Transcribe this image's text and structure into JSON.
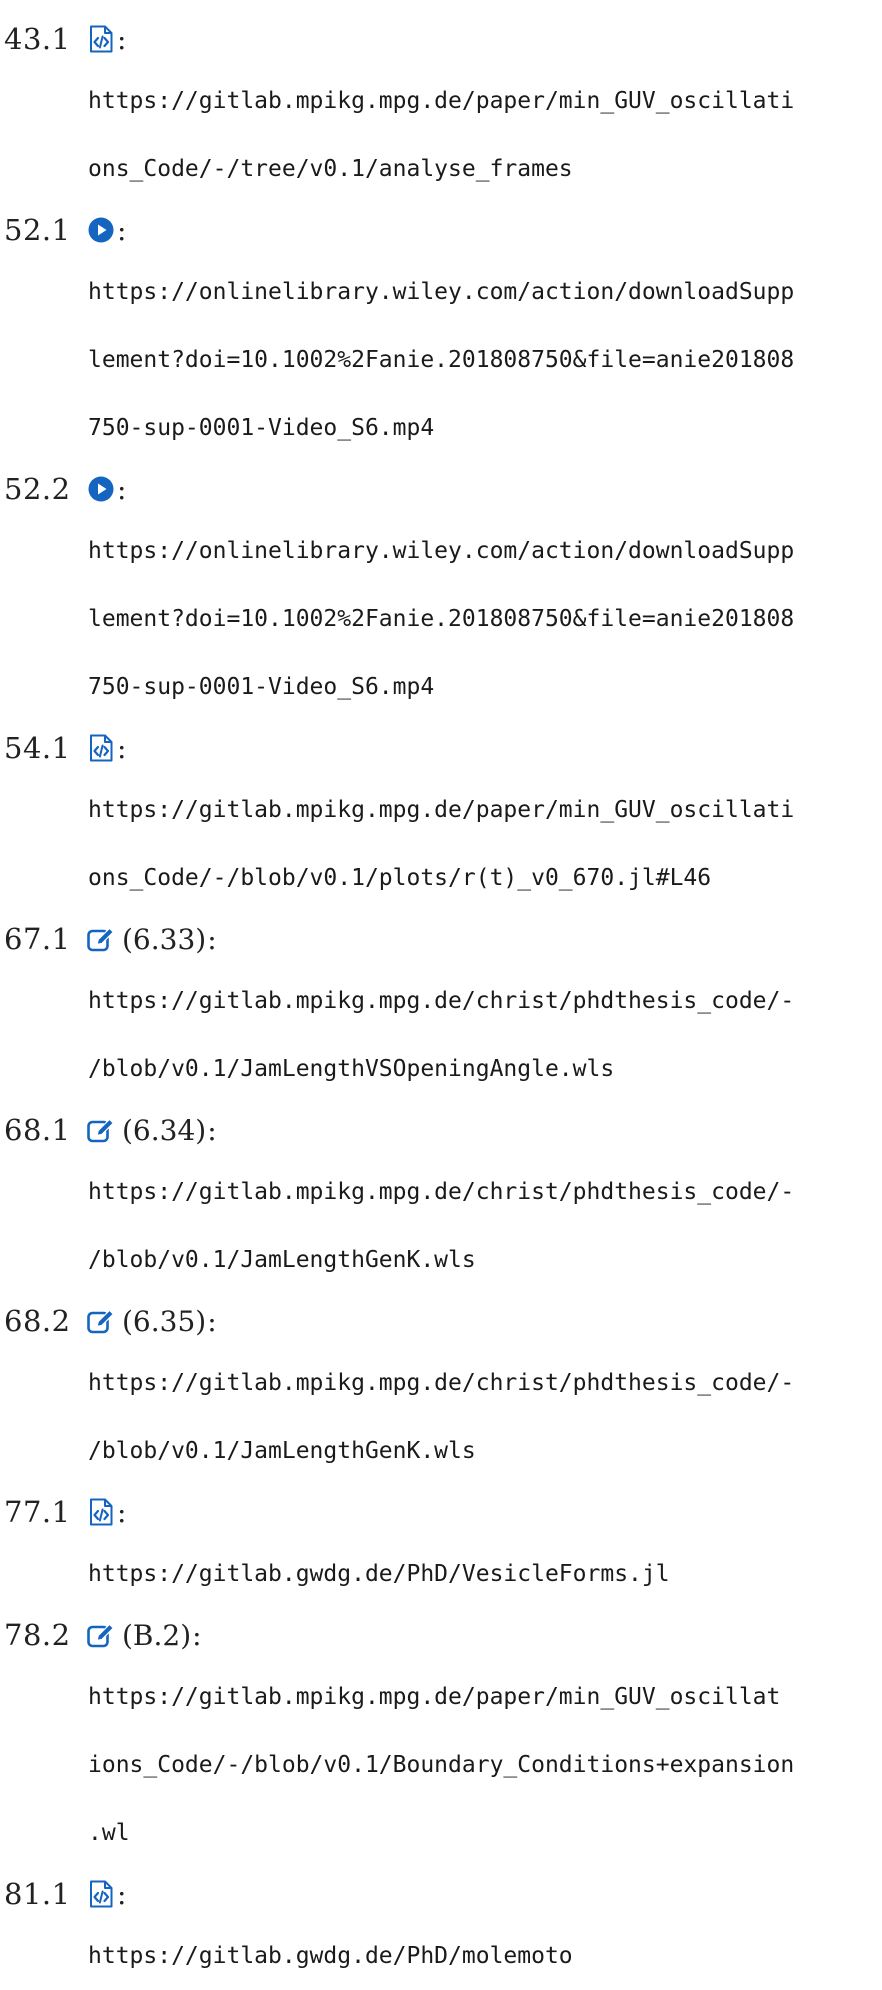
{
  "entries": [
    {
      "number": "43.1",
      "icon": "code-icon",
      "equation": "",
      "lines": [
        "https://gitlab.mpikg.mpg.de/paper/min_GUV_oscillati",
        "ons_Code/-/tree/v0.1/analyse_frames"
      ]
    },
    {
      "number": "52.1",
      "icon": "play-icon",
      "equation": "",
      "lines": [
        "https://onlinelibrary.wiley.com/action/downloadSupp",
        "lement?doi=10.1002%2Fanie.201808750&file=anie201808",
        "750-sup-0001-Video_S6.mp4"
      ]
    },
    {
      "number": "52.2",
      "icon": "play-icon",
      "equation": "",
      "lines": [
        "https://onlinelibrary.wiley.com/action/downloadSupp",
        "lement?doi=10.1002%2Fanie.201808750&file=anie201808",
        "750-sup-0001-Video_S6.mp4"
      ]
    },
    {
      "number": "54.1",
      "icon": "code-icon",
      "equation": "",
      "lines": [
        "https://gitlab.mpikg.mpg.de/paper/min_GUV_oscillati",
        "ons_Code/-/blob/v0.1/plots/r(t)_v0_670.jl#L46"
      ]
    },
    {
      "number": "67.1",
      "icon": "edit-icon",
      "equation": "(6.33)",
      "lines": [
        "https://gitlab.mpikg.mpg.de/christ/phdthesis_code/-",
        "/blob/v0.1/JamLengthVSOpeningAngle.wls"
      ]
    },
    {
      "number": "68.1",
      "icon": "edit-icon",
      "equation": "(6.34)",
      "lines": [
        "https://gitlab.mpikg.mpg.de/christ/phdthesis_code/-",
        "/blob/v0.1/JamLengthGenK.wls"
      ]
    },
    {
      "number": "68.2",
      "icon": "edit-icon",
      "equation": "(6.35)",
      "lines": [
        "https://gitlab.mpikg.mpg.de/christ/phdthesis_code/-",
        "/blob/v0.1/JamLengthGenK.wls"
      ]
    },
    {
      "number": "77.1",
      "icon": "code-icon",
      "equation": "",
      "lines": [
        "https://gitlab.gwdg.de/PhD/VesicleForms.jl"
      ]
    },
    {
      "number": "78.2",
      "icon": "edit-icon",
      "equation": "(B.2)",
      "lines": [
        "https://gitlab.mpikg.mpg.de/paper/min_GUV_oscillat",
        "ions_Code/-/blob/v0.1/Boundary_Conditions+expansion",
        ".wl"
      ]
    },
    {
      "number": "81.1",
      "icon": "code-icon",
      "equation": "",
      "lines": [
        "https://gitlab.gwdg.de/PhD/molemoto"
      ]
    }
  ],
  "colors": {
    "icon_blue": "#1565c0",
    "text": "#1a1a1a"
  }
}
